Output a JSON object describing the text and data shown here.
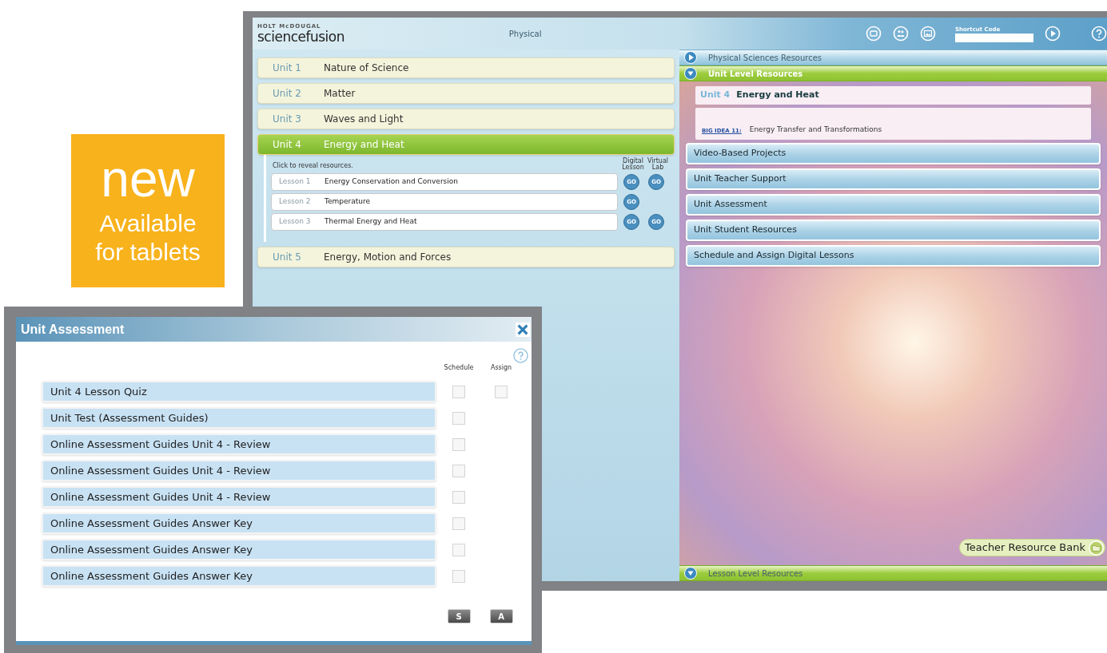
{
  "promo": {
    "headline": "new",
    "lines": [
      "Available",
      "for tablets"
    ]
  },
  "app": {
    "logo_tagline": "HOLT McDOUGAL",
    "logo": "sciencefusion",
    "title": "Physical",
    "shortcut_label": "Shortcut Code",
    "units": [
      {
        "label": "Unit 1",
        "name": "Nature of Science",
        "selected": false
      },
      {
        "label": "Unit 2",
        "name": "Matter",
        "selected": false
      },
      {
        "label": "Unit 3",
        "name": "Waves and Light",
        "selected": false
      },
      {
        "label": "Unit 4",
        "name": "Energy and Heat",
        "selected": true,
        "hint": "Click to reveal resources.",
        "columns": [
          "Digital Lesson",
          "Virtual Lab"
        ],
        "lessons": [
          {
            "label": "Lesson 1",
            "name": "Energy Conservation and Conversion",
            "digital_lesson": "GO",
            "virtual_lab": "GO"
          },
          {
            "label": "Lesson 2",
            "name": "Temperature",
            "digital_lesson": "GO"
          },
          {
            "label": "Lesson 3",
            "name": "Thermal Energy and Heat",
            "digital_lesson": "GO",
            "virtual_lab": "GO"
          }
        ]
      },
      {
        "label": "Unit 5",
        "name": "Energy, Motion and Forces",
        "selected": false
      }
    ],
    "sections": [
      {
        "label": "Physical Sciences Resources",
        "expanded": false
      },
      {
        "label": "Unit Level Resources",
        "expanded": true
      }
    ],
    "unit_card": {
      "label": "Unit 4",
      "name": "Energy and Heat"
    },
    "big_idea": {
      "label": "BIG IDEA 11:",
      "text": "Energy Transfer and Transformations"
    },
    "resources": [
      "Video-Based Projects",
      "Unit Teacher Support",
      "Unit Assessment",
      "Unit Student Resources",
      "Schedule and Assign Digital Lessons"
    ],
    "teacher_bank": "Teacher Resource Bank",
    "bottom_section": {
      "label": "Lesson Level Resources",
      "expanded": true
    }
  },
  "dialog": {
    "title": "Unit Assessment",
    "columns": [
      "Schedule",
      "Assign"
    ],
    "items": [
      {
        "label": "Unit 4 Lesson Quiz",
        "schedule_checked": false,
        "assign_checked": false
      },
      {
        "label": "Unit Test (Assessment Guides)",
        "schedule_checked": false
      },
      {
        "label": "Online Assessment Guides Unit 4 - Review",
        "schedule_checked": false
      },
      {
        "label": "Online Assessment Guides Unit 4 - Review",
        "schedule_checked": false
      },
      {
        "label": "Online Assessment Guides Unit 4 - Review",
        "schedule_checked": false
      },
      {
        "label": "Online Assessment Guides Answer Key",
        "schedule_checked": false
      },
      {
        "label": "Online Assessment Guides Answer Key",
        "schedule_checked": false
      },
      {
        "label": "Online Assessment Guides Answer Key",
        "schedule_checked": false
      }
    ],
    "buttons": [
      "S",
      "A"
    ]
  }
}
